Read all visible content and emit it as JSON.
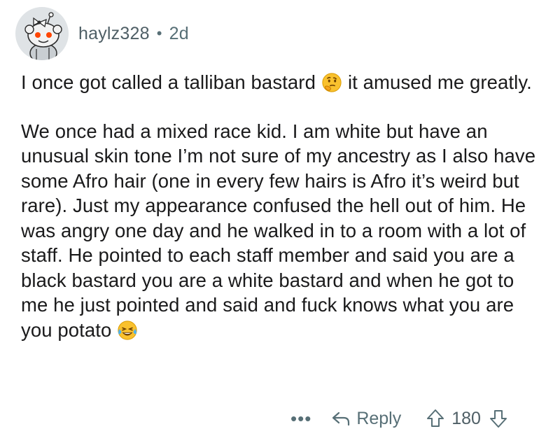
{
  "comment": {
    "username": "haylz328",
    "separator": "•",
    "age": "2d",
    "paragraph1_before": "I once got called a talliban bastard",
    "paragraph1_after": "it amused me greatly.",
    "paragraph1_emoji": "thinking-face-emoji",
    "paragraph2_text": "We once had a mixed race kid. I am white but have an unusual skin tone I’m not sure of my ancestry as I also have some Afro hair (one in every few hairs is Afro it’s weird but rare). Just my appearance confused the hell out of him. He was angry one day and he walked in to a room with a lot of staff. He pointed to each staff member and said you are a black bastard you are a white bastard and when he got to me he just pointed and said and fuck knows what you are you potato",
    "paragraph2_emoji": "laughing-crying-face-emoji"
  },
  "actions": {
    "more_label": "•••",
    "reply_label": "Reply",
    "score": "180",
    "upvote_icon": "arrow-up-icon",
    "downvote_icon": "arrow-down-icon",
    "reply_icon": "reply-arrow-icon"
  },
  "colors": {
    "text": "#1a1a1b",
    "meta": "#576f76",
    "avatar_bg": "#dfe3e6",
    "snoo_accent": "#ff4500"
  }
}
